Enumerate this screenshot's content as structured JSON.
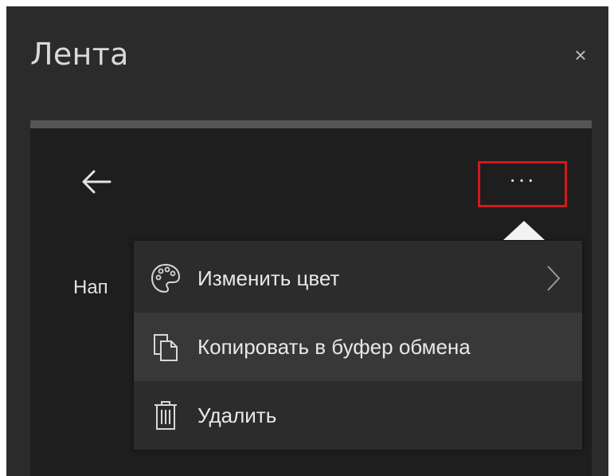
{
  "panel": {
    "title": "Лента",
    "close_icon": "close-icon",
    "close_glyph": "×"
  },
  "card": {
    "back_icon": "arrow-left-icon",
    "more_icon": "more-horizontal-icon",
    "more_glyph": "···",
    "note_preview_text": "Нап"
  },
  "context_menu": {
    "items": [
      {
        "label": "Изменить цвет",
        "icon": "palette-icon",
        "has_submenu": true
      },
      {
        "label": "Копировать в буфер обмена",
        "icon": "copy-icon",
        "has_submenu": false
      },
      {
        "label": "Удалить",
        "icon": "trash-icon",
        "has_submenu": false
      }
    ]
  },
  "colors": {
    "panel_bg": "#2b2b2b",
    "card_bg": "#1e1e1e",
    "menu_bg": "#2c2c2c",
    "highlight_border": "#d1191c",
    "text": "#e8e8e8"
  }
}
